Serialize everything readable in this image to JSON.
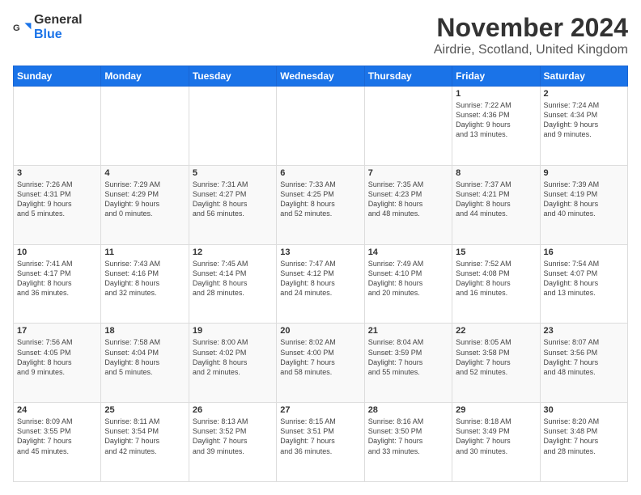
{
  "logo": {
    "general": "General",
    "blue": "Blue"
  },
  "title": "November 2024",
  "subtitle": "Airdrie, Scotland, United Kingdom",
  "headers": [
    "Sunday",
    "Monday",
    "Tuesday",
    "Wednesday",
    "Thursday",
    "Friday",
    "Saturday"
  ],
  "weeks": [
    [
      {
        "day": "",
        "info": ""
      },
      {
        "day": "",
        "info": ""
      },
      {
        "day": "",
        "info": ""
      },
      {
        "day": "",
        "info": ""
      },
      {
        "day": "",
        "info": ""
      },
      {
        "day": "1",
        "info": "Sunrise: 7:22 AM\nSunset: 4:36 PM\nDaylight: 9 hours\nand 13 minutes."
      },
      {
        "day": "2",
        "info": "Sunrise: 7:24 AM\nSunset: 4:34 PM\nDaylight: 9 hours\nand 9 minutes."
      }
    ],
    [
      {
        "day": "3",
        "info": "Sunrise: 7:26 AM\nSunset: 4:31 PM\nDaylight: 9 hours\nand 5 minutes."
      },
      {
        "day": "4",
        "info": "Sunrise: 7:29 AM\nSunset: 4:29 PM\nDaylight: 9 hours\nand 0 minutes."
      },
      {
        "day": "5",
        "info": "Sunrise: 7:31 AM\nSunset: 4:27 PM\nDaylight: 8 hours\nand 56 minutes."
      },
      {
        "day": "6",
        "info": "Sunrise: 7:33 AM\nSunset: 4:25 PM\nDaylight: 8 hours\nand 52 minutes."
      },
      {
        "day": "7",
        "info": "Sunrise: 7:35 AM\nSunset: 4:23 PM\nDaylight: 8 hours\nand 48 minutes."
      },
      {
        "day": "8",
        "info": "Sunrise: 7:37 AM\nSunset: 4:21 PM\nDaylight: 8 hours\nand 44 minutes."
      },
      {
        "day": "9",
        "info": "Sunrise: 7:39 AM\nSunset: 4:19 PM\nDaylight: 8 hours\nand 40 minutes."
      }
    ],
    [
      {
        "day": "10",
        "info": "Sunrise: 7:41 AM\nSunset: 4:17 PM\nDaylight: 8 hours\nand 36 minutes."
      },
      {
        "day": "11",
        "info": "Sunrise: 7:43 AM\nSunset: 4:16 PM\nDaylight: 8 hours\nand 32 minutes."
      },
      {
        "day": "12",
        "info": "Sunrise: 7:45 AM\nSunset: 4:14 PM\nDaylight: 8 hours\nand 28 minutes."
      },
      {
        "day": "13",
        "info": "Sunrise: 7:47 AM\nSunset: 4:12 PM\nDaylight: 8 hours\nand 24 minutes."
      },
      {
        "day": "14",
        "info": "Sunrise: 7:49 AM\nSunset: 4:10 PM\nDaylight: 8 hours\nand 20 minutes."
      },
      {
        "day": "15",
        "info": "Sunrise: 7:52 AM\nSunset: 4:08 PM\nDaylight: 8 hours\nand 16 minutes."
      },
      {
        "day": "16",
        "info": "Sunrise: 7:54 AM\nSunset: 4:07 PM\nDaylight: 8 hours\nand 13 minutes."
      }
    ],
    [
      {
        "day": "17",
        "info": "Sunrise: 7:56 AM\nSunset: 4:05 PM\nDaylight: 8 hours\nand 9 minutes."
      },
      {
        "day": "18",
        "info": "Sunrise: 7:58 AM\nSunset: 4:04 PM\nDaylight: 8 hours\nand 5 minutes."
      },
      {
        "day": "19",
        "info": "Sunrise: 8:00 AM\nSunset: 4:02 PM\nDaylight: 8 hours\nand 2 minutes."
      },
      {
        "day": "20",
        "info": "Sunrise: 8:02 AM\nSunset: 4:00 PM\nDaylight: 7 hours\nand 58 minutes."
      },
      {
        "day": "21",
        "info": "Sunrise: 8:04 AM\nSunset: 3:59 PM\nDaylight: 7 hours\nand 55 minutes."
      },
      {
        "day": "22",
        "info": "Sunrise: 8:05 AM\nSunset: 3:58 PM\nDaylight: 7 hours\nand 52 minutes."
      },
      {
        "day": "23",
        "info": "Sunrise: 8:07 AM\nSunset: 3:56 PM\nDaylight: 7 hours\nand 48 minutes."
      }
    ],
    [
      {
        "day": "24",
        "info": "Sunrise: 8:09 AM\nSunset: 3:55 PM\nDaylight: 7 hours\nand 45 minutes."
      },
      {
        "day": "25",
        "info": "Sunrise: 8:11 AM\nSunset: 3:54 PM\nDaylight: 7 hours\nand 42 minutes."
      },
      {
        "day": "26",
        "info": "Sunrise: 8:13 AM\nSunset: 3:52 PM\nDaylight: 7 hours\nand 39 minutes."
      },
      {
        "day": "27",
        "info": "Sunrise: 8:15 AM\nSunset: 3:51 PM\nDaylight: 7 hours\nand 36 minutes."
      },
      {
        "day": "28",
        "info": "Sunrise: 8:16 AM\nSunset: 3:50 PM\nDaylight: 7 hours\nand 33 minutes."
      },
      {
        "day": "29",
        "info": "Sunrise: 8:18 AM\nSunset: 3:49 PM\nDaylight: 7 hours\nand 30 minutes."
      },
      {
        "day": "30",
        "info": "Sunrise: 8:20 AM\nSunset: 3:48 PM\nDaylight: 7 hours\nand 28 minutes."
      }
    ]
  ]
}
